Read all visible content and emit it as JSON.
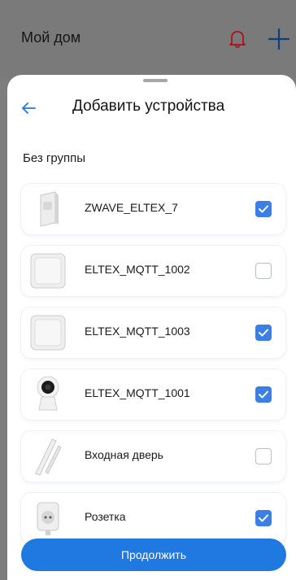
{
  "header": {
    "title": "Мой дом",
    "icons": [
      "bell-icon",
      "plus-icon"
    ]
  },
  "sheet": {
    "title": "Добавить устройства",
    "group_title": "Без группы",
    "devices": [
      {
        "name": "ZWAVE_ELTEX_7",
        "checked": true,
        "icon": "motion-sensor"
      },
      {
        "name": "ELTEX_MQTT_1002",
        "checked": false,
        "icon": "wall-switch"
      },
      {
        "name": "ELTEX_MQTT_1003",
        "checked": true,
        "icon": "wall-switch"
      },
      {
        "name": "ELTEX_MQTT_1001",
        "checked": true,
        "icon": "camera"
      },
      {
        "name": "Входная дверь",
        "checked": false,
        "icon": "door-sensor"
      },
      {
        "name": "Розетка",
        "checked": true,
        "icon": "smart-plug"
      }
    ],
    "continue_label": "Продолжить"
  },
  "colors": {
    "accent": "#1f79e0",
    "checkbox": "#3b7fe6",
    "backdrop": "#7a7a7a"
  }
}
